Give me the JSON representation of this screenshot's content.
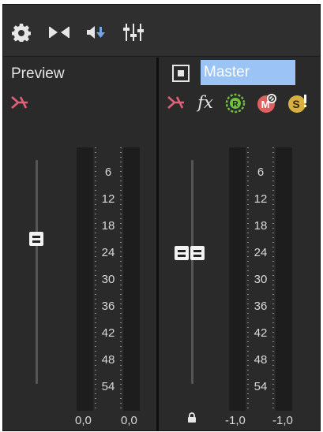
{
  "toolbar": {
    "buttons": [
      {
        "icon": "gear-icon"
      },
      {
        "icon": "bowtie-icon"
      },
      {
        "icon": "downmix-icon"
      },
      {
        "icon": "mixer-sliders-icon"
      }
    ]
  },
  "preview": {
    "label": "Preview",
    "route_icon": "route-icon",
    "peak_left": "0,0",
    "peak_right": "0,0"
  },
  "master": {
    "name": "Master",
    "icons": [
      "square-icon",
      "route-icon",
      "fx-icon",
      "record-icon",
      "mute-icon",
      "solo-icon"
    ],
    "peak_left": "-1,0",
    "peak_right": "-1,0"
  },
  "meter_scale": [
    "6",
    "12",
    "18",
    "24",
    "30",
    "36",
    "42",
    "48",
    "54"
  ],
  "colors": {
    "panel": "#2a2a2a",
    "selection": "#9cc3f5",
    "route": "#e0607a",
    "fx_badge": "#6fbf40",
    "mute_badge": "#e06060",
    "solo_badge": "#d9b040"
  }
}
